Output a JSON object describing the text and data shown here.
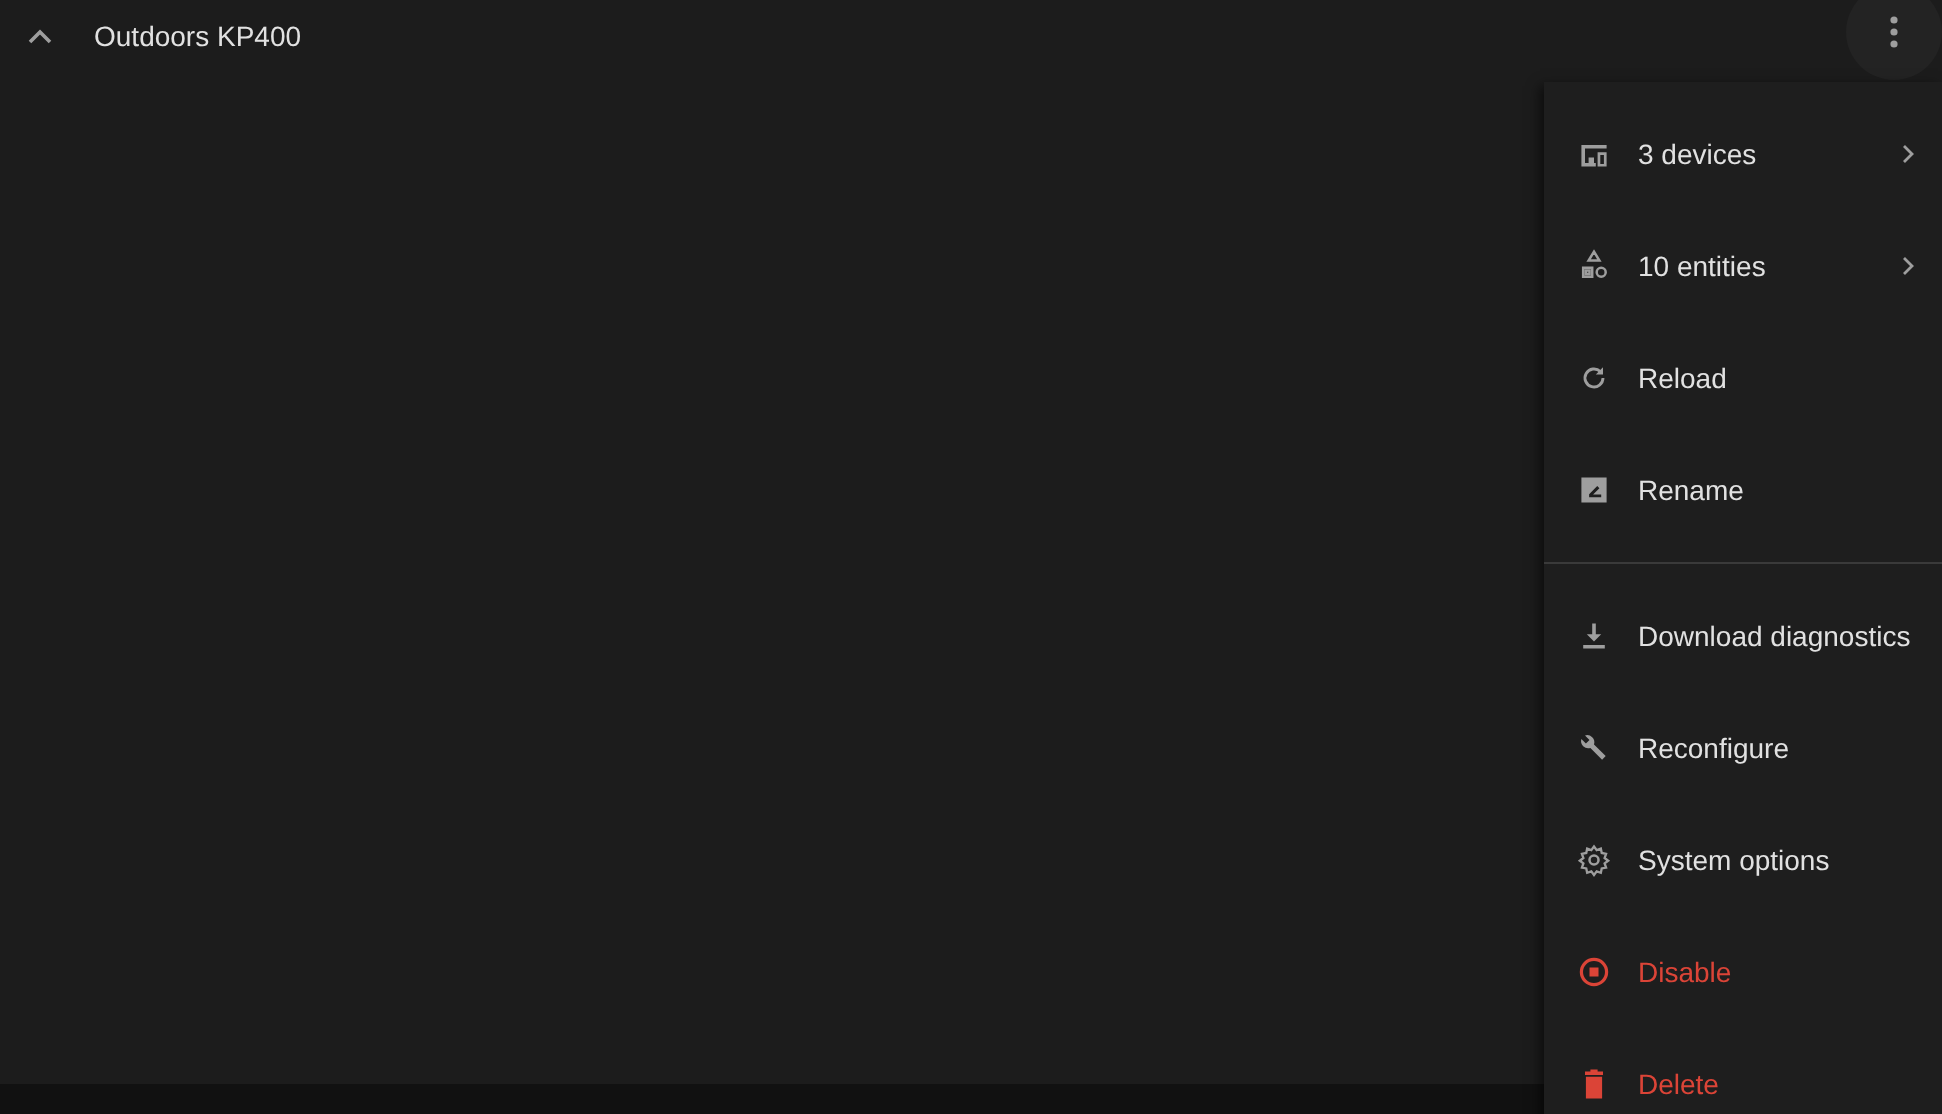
{
  "header": {
    "title": "Outdoors KP400",
    "expanded": true
  },
  "menu": {
    "open": true,
    "items": [
      {
        "label": "3 devices",
        "submenu": true,
        "kind": "normal"
      },
      {
        "label": "10 entities",
        "submenu": true,
        "kind": "normal"
      },
      {
        "label": "Reload",
        "submenu": false,
        "kind": "normal"
      },
      {
        "label": "Rename",
        "submenu": false,
        "kind": "normal"
      },
      {
        "kind": "divider"
      },
      {
        "label": "Download diagnostics",
        "submenu": false,
        "kind": "normal"
      },
      {
        "label": "Reconfigure",
        "submenu": false,
        "kind": "normal"
      },
      {
        "label": "System options",
        "submenu": false,
        "kind": "normal"
      },
      {
        "label": "Disable",
        "submenu": false,
        "kind": "danger"
      },
      {
        "label": "Delete",
        "submenu": false,
        "kind": "danger"
      }
    ]
  }
}
